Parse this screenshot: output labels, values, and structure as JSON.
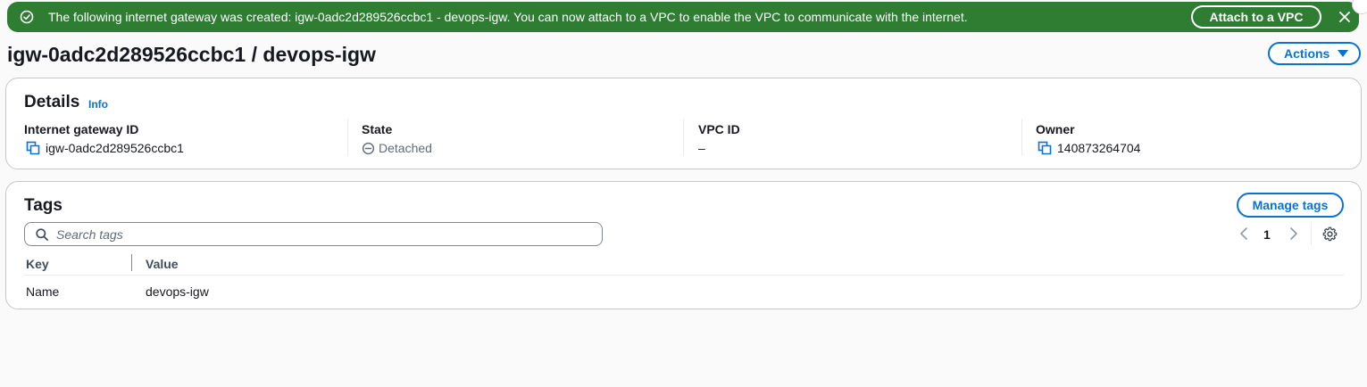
{
  "flash": {
    "message": "The following internet gateway was created: igw-0adc2d289526ccbc1 - devops-igw. You can now attach to a VPC to enable the VPC to communicate with the internet.",
    "action_label": "Attach to a VPC",
    "color": "#2e7d32"
  },
  "page": {
    "title": "igw-0adc2d289526ccbc1 / devops-igw",
    "actions_label": "Actions"
  },
  "details": {
    "heading": "Details",
    "info_label": "Info",
    "fields": [
      {
        "label": "Internet gateway ID",
        "value": "igw-0adc2d289526ccbc1",
        "icon": "copy-icon"
      },
      {
        "label": "State",
        "value": "Detached",
        "icon": "detached-status-icon"
      },
      {
        "label": "VPC ID",
        "value": "–"
      },
      {
        "label": "Owner",
        "value": "140873264704",
        "icon": "copy-icon"
      }
    ]
  },
  "tags": {
    "heading": "Tags",
    "manage_label": "Manage tags",
    "search_placeholder": "Search tags",
    "search_value": "",
    "page_number": "1",
    "columns": [
      "Key",
      "Value"
    ],
    "rows": [
      {
        "key": "Name",
        "value": "devops-igw"
      }
    ]
  },
  "colors": {
    "accent": "#0972d3",
    "text": "#16191f",
    "muted": "#5f6b7a"
  }
}
